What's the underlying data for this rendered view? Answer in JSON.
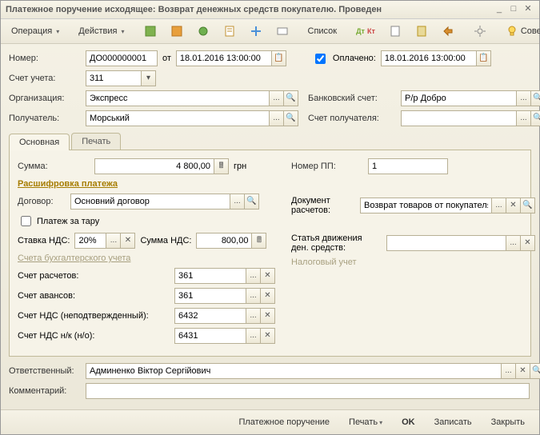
{
  "title": "Платежное поручение исходящее: Возврат денежных средств покупателю. Проведен",
  "menu": {
    "operation": "Операция",
    "actions": "Действия",
    "list": "Список",
    "advice": "Советы"
  },
  "f": {
    "number_lbl": "Номер:",
    "number": "ДО000000001",
    "ot": "от",
    "date1": "18.01.2016 13:00:00",
    "paid": "Оплачено:",
    "date2": "18.01.2016 13:00:00",
    "account_lbl": "Счет учета:",
    "account": "311",
    "org_lbl": "Организация:",
    "org": "Экспресс",
    "bank_lbl": "Банковский счет:",
    "bank": "Р/р Добро",
    "recip_lbl": "Получатель:",
    "recip": "Морський",
    "recip_acc_lbl": "Счет получателя:"
  },
  "tabs": {
    "main": "Основная",
    "print": "Печать"
  },
  "m": {
    "sum_lbl": "Сумма:",
    "sum": "4 800,00",
    "cur": "грн",
    "pp_lbl": "Номер ПП:",
    "pp": "1",
    "decode": "Расшифровка платежа",
    "contract_lbl": "Договор:",
    "contract": "Основний договор",
    "doc_lbl": "Документ расчетов:",
    "doc": "Возврат товаров от покупателя",
    "tare": "Платеж за тару",
    "vat_rate_lbl": "Ставка НДС:",
    "vat_rate": "20%",
    "vat_sum_lbl": "Сумма НДС:",
    "vat_sum": "800,00",
    "flow_lbl": "Статья движения ден. средств:",
    "tax": "Налоговый учет",
    "acc_h": "Счета бухгалтерского учета",
    "a1_lbl": "Счет расчетов:",
    "a1": "361",
    "a2_lbl": "Счет авансов:",
    "a2": "361",
    "a3_lbl": "Счет НДС (неподтвержденный):",
    "a3": "6432",
    "a4_lbl": "Счет НДС н/к (н/о):",
    "a4": "6431"
  },
  "b": {
    "resp_lbl": "Ответственный:",
    "resp": "Админенко Віктор Сергійович",
    "comment_lbl": "Комментарий:"
  },
  "ft": {
    "pp": "Платежное поручение",
    "print": "Печать",
    "ok": "OK",
    "save": "Записать",
    "close": "Закрыть"
  }
}
